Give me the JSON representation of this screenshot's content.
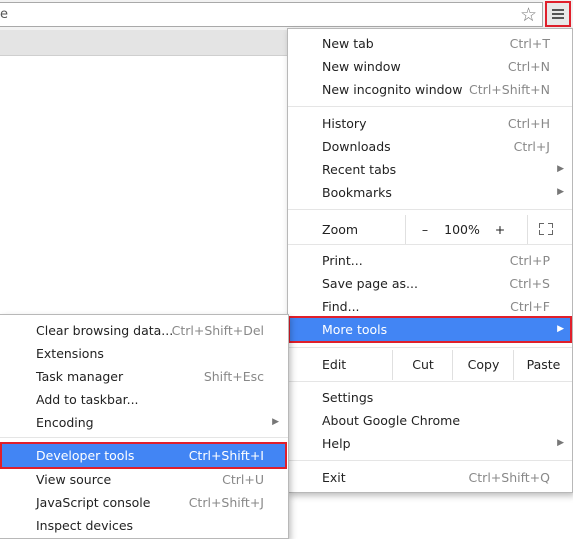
{
  "toolbar": {
    "omnibox_text": "e",
    "star_icon": "star-icon",
    "menu_icon": "hamburger-menu-icon"
  },
  "main_menu": {
    "group1": [
      {
        "label": "New tab",
        "shortcut": "Ctrl+T"
      },
      {
        "label": "New window",
        "shortcut": "Ctrl+N"
      },
      {
        "label": "New incognito window",
        "shortcut": "Ctrl+Shift+N"
      }
    ],
    "group2": [
      {
        "label": "History",
        "shortcut": "Ctrl+H"
      },
      {
        "label": "Downloads",
        "shortcut": "Ctrl+J"
      },
      {
        "label": "Recent tabs",
        "shortcut": ""
      },
      {
        "label": "Bookmarks",
        "shortcut": ""
      }
    ],
    "zoom": {
      "label": "Zoom",
      "minus": "–",
      "value": "100%",
      "plus": "+",
      "fullscreen_icon": "fullscreen-icon"
    },
    "group3": [
      {
        "label": "Print...",
        "shortcut": "Ctrl+P"
      },
      {
        "label": "Save page as...",
        "shortcut": "Ctrl+S"
      },
      {
        "label": "Find...",
        "shortcut": "Ctrl+F"
      },
      {
        "label": "More tools",
        "shortcut": ""
      }
    ],
    "edit": {
      "label": "Edit",
      "cut": "Cut",
      "copy": "Copy",
      "paste": "Paste"
    },
    "group4": [
      {
        "label": "Settings",
        "shortcut": ""
      },
      {
        "label": "About Google Chrome",
        "shortcut": ""
      },
      {
        "label": "Help",
        "shortcut": ""
      }
    ],
    "exit": {
      "label": "Exit",
      "shortcut": "Ctrl+Shift+Q"
    }
  },
  "sub_menu": {
    "group1": [
      {
        "label": "Clear browsing data...",
        "shortcut": "Ctrl+Shift+Del"
      },
      {
        "label": "Extensions",
        "shortcut": ""
      },
      {
        "label": "Task manager",
        "shortcut": "Shift+Esc"
      },
      {
        "label": "Add to taskbar...",
        "shortcut": ""
      },
      {
        "label": "Encoding",
        "shortcut": ""
      }
    ],
    "group2": [
      {
        "label": "Developer tools",
        "shortcut": "Ctrl+Shift+I"
      },
      {
        "label": "View source",
        "shortcut": "Ctrl+U"
      },
      {
        "label": "JavaScript console",
        "shortcut": "Ctrl+Shift+J"
      },
      {
        "label": "Inspect devices",
        "shortcut": ""
      }
    ]
  },
  "colors": {
    "highlight": "#4285f4",
    "annotation_border": "#e01f2b"
  }
}
